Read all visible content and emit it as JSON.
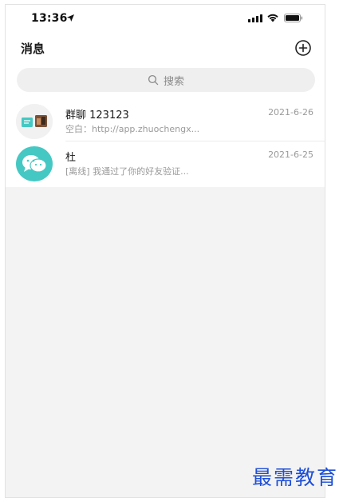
{
  "status_bar": {
    "time": "13:36",
    "icons": [
      "location-arrow-icon",
      "cellular-signal-icon",
      "wifi-icon",
      "battery-icon"
    ]
  },
  "header": {
    "title": "消息",
    "add_icon": "plus-circle-icon"
  },
  "search": {
    "placeholder": "搜索",
    "icon": "search-icon"
  },
  "conversations": [
    {
      "name": "群聊 123123",
      "preview": "空白：http://app.zhuochengx...",
      "date": "2021-6-26",
      "avatar": "group-avatar-icon"
    },
    {
      "name": "杜",
      "preview": "[离线] 我通过了你的好友验证...",
      "date": "2021-6-25",
      "avatar": "chat-bubble-avatar-icon"
    }
  ],
  "watermark": "最需教育",
  "colors": {
    "list_background": "#f3f3f3",
    "avatar_teal": "#45c8c3",
    "watermark_blue": "#1e4fd6"
  }
}
